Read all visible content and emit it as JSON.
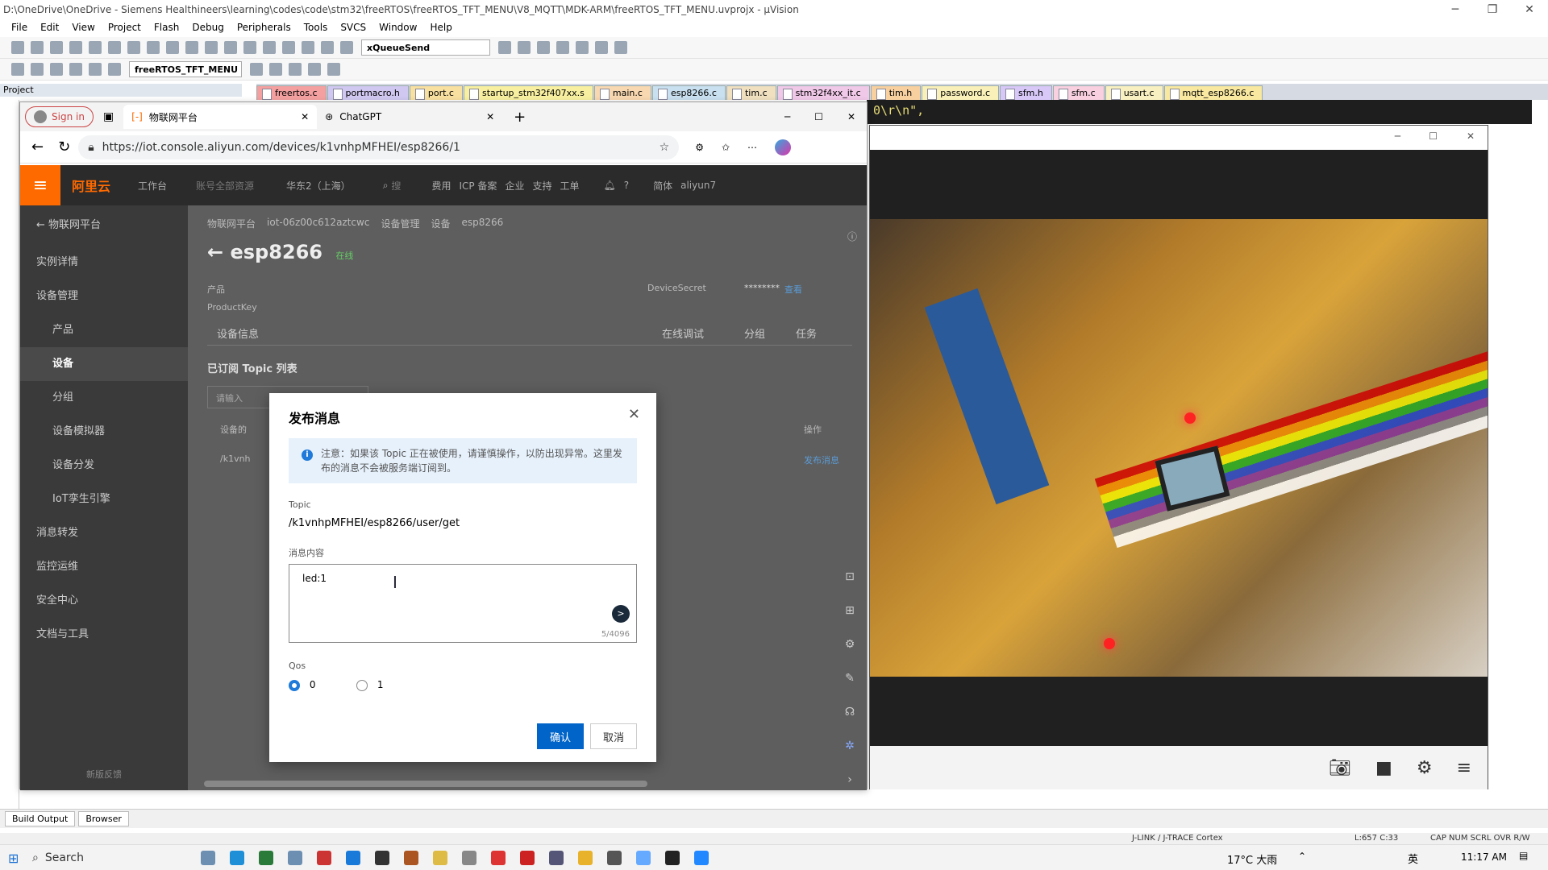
{
  "window": {
    "title": "D:\\OneDrive\\OneDrive - Siemens Healthineers\\learning\\codes\\code\\stm32\\freeRTOS\\freeRTOS_TFT_MENU\\V8_MQTT\\MDK-ARM\\freeRTOS_TFT_MENU.uvprojx - µVision"
  },
  "menu": [
    "File",
    "Edit",
    "View",
    "Project",
    "Flash",
    "Debug",
    "Peripherals",
    "Tools",
    "SVCS",
    "Window",
    "Help"
  ],
  "toolbar": {
    "find_value": "xQueueSend",
    "target_value": "freeRTOS_TFT_MENU"
  },
  "project_pane": {
    "title": "Project"
  },
  "file_tabs": [
    {
      "label": "freertos.c",
      "color": "#f4a0a0"
    },
    {
      "label": "portmacro.h",
      "color": "#d0c8f0"
    },
    {
      "label": "port.c",
      "color": "#f8e0a0"
    },
    {
      "label": "startup_stm32f407xx.s",
      "color": "#f8f0a0"
    },
    {
      "label": "main.c",
      "color": "#f8d8b0"
    },
    {
      "label": "esp8266.c",
      "color": "#c8e0f0"
    },
    {
      "label": "tim.c",
      "color": "#f0e0c0"
    },
    {
      "label": "stm32f4xx_it.c",
      "color": "#f0c8e8"
    },
    {
      "label": "tim.h",
      "color": "#f8d0a0"
    },
    {
      "label": "password.c",
      "color": "#f8f0b8"
    },
    {
      "label": "sfm.h",
      "color": "#d8c8f8"
    },
    {
      "label": "sfm.c",
      "color": "#f8d0e0"
    },
    {
      "label": "usart.c",
      "color": "#f8f0c0"
    },
    {
      "label": "mqtt_esp8266.c",
      "color": "#f8e8a0"
    }
  ],
  "code_line": "0\\r\\n\",",
  "edge": {
    "profile_label": "Sign in",
    "tab1": "物联网平台",
    "tab2": "ChatGPT",
    "url": "https://iot.console.aliyun.com/devices/k1vnhpMFHEI/esp8266/1"
  },
  "aliyun": {
    "logo": "阿里云",
    "workbench": "工作台",
    "account_scope": "账号全部资源",
    "region": "华东2（上海）",
    "search": "搜",
    "top_links": [
      "费用",
      "ICP 备案",
      "企业",
      "支持",
      "工单"
    ],
    "lang": "简体",
    "user": "aliyun7",
    "back_platform": "物联网平台",
    "side_items": [
      {
        "label": "实例详情",
        "cls": "it"
      },
      {
        "label": "设备管理",
        "cls": "it"
      },
      {
        "label": "产品",
        "cls": "it sub"
      },
      {
        "label": "设备",
        "cls": "it sub sel"
      },
      {
        "label": "分组",
        "cls": "it sub"
      },
      {
        "label": "设备模拟器",
        "cls": "it sub"
      },
      {
        "label": "设备分发",
        "cls": "it sub"
      },
      {
        "label": "IoT孪生引擎",
        "cls": "it sub"
      },
      {
        "label": "消息转发",
        "cls": "it"
      },
      {
        "label": "监控运维",
        "cls": "it"
      },
      {
        "label": "安全中心",
        "cls": "it"
      },
      {
        "label": "文档与工具",
        "cls": "it"
      }
    ],
    "feedback": "新版反馈",
    "breadcrumb": [
      "物联网平台",
      "iot-06z00c612aztcwc",
      "设备管理",
      "设备",
      "esp8266"
    ],
    "device_name": "esp8266",
    "status": "在线",
    "product_label": "产品",
    "productkey_label": "ProductKey",
    "device_secret_label": "DeviceSecret",
    "device_secret_mask": "********",
    "view_link": "查看",
    "tabs": [
      "设备信息",
      "在线调试",
      "分组",
      "任务"
    ],
    "subscribed": "已订阅 Topic 列表",
    "search_placeholder": "请输入",
    "col_device": "设备的",
    "col_action": "操作",
    "row_topic": "/k1vnh",
    "publish_link": "发布消息"
  },
  "modal": {
    "title": "发布消息",
    "notice": "注意：如果该 Topic 正在被使用，请谨慎操作，以防出现异常。这里发布的消息不会被服务端订阅到。",
    "topic_label": "Topic",
    "topic_value": "/k1vnhpMFHEI/esp8266/user/get",
    "content_label": "消息内容",
    "content_value": "led:1",
    "char_count": "5/4096",
    "qos_label": "Qos",
    "qos_options": [
      "0",
      "1"
    ],
    "qos_selected": "0",
    "confirm": "确认",
    "cancel": "取消"
  },
  "bottom_tabs": [
    "Build Output",
    "Browser"
  ],
  "status": {
    "debugger": "J-LINK / J-TRACE Cortex",
    "position": "L:657 C:33",
    "flags": "CAP  NUM  SCRL  OVR  R/W"
  },
  "taskbar": {
    "search": "Search",
    "weather": "17°C  大雨",
    "ime": "英",
    "time": "11:17 AM"
  }
}
